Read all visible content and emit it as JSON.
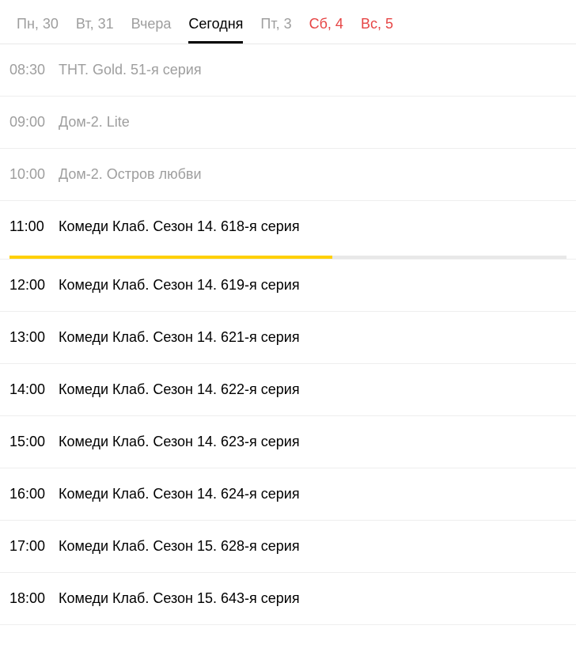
{
  "tabs": [
    {
      "label": "Пн, 30",
      "active": false,
      "weekend": false
    },
    {
      "label": "Вт, 31",
      "active": false,
      "weekend": false
    },
    {
      "label": "Вчера",
      "active": false,
      "weekend": false
    },
    {
      "label": "Сегодня",
      "active": true,
      "weekend": false
    },
    {
      "label": "Пт, 3",
      "active": false,
      "weekend": false
    },
    {
      "label": "Сб, 4",
      "active": false,
      "weekend": true
    },
    {
      "label": "Вс, 5",
      "active": false,
      "weekend": true
    }
  ],
  "schedule": [
    {
      "time": "08:30",
      "title": "ТНТ. Gold. 51-я серия",
      "state": "past"
    },
    {
      "time": "09:00",
      "title": "Дом-2. Lite",
      "state": "past"
    },
    {
      "time": "10:00",
      "title": "Дом-2. Остров любви",
      "state": "past"
    },
    {
      "time": "11:00",
      "title": "Комеди Клаб. Сезон 14. 618-я серия",
      "state": "current",
      "progress": 58
    },
    {
      "time": "12:00",
      "title": "Комеди Клаб. Сезон 14. 619-я серия",
      "state": "upcoming"
    },
    {
      "time": "13:00",
      "title": "Комеди Клаб. Сезон 14. 621-я серия",
      "state": "upcoming"
    },
    {
      "time": "14:00",
      "title": "Комеди Клаб. Сезон 14. 622-я серия",
      "state": "upcoming"
    },
    {
      "time": "15:00",
      "title": "Комеди Клаб. Сезон 14. 623-я серия",
      "state": "upcoming"
    },
    {
      "time": "16:00",
      "title": "Комеди Клаб. Сезон 14. 624-я серия",
      "state": "upcoming"
    },
    {
      "time": "17:00",
      "title": "Комеди Клаб. Сезон 15. 628-я серия",
      "state": "upcoming"
    },
    {
      "time": "18:00",
      "title": "Комеди Клаб. Сезон 15. 643-я серия",
      "state": "upcoming"
    }
  ]
}
